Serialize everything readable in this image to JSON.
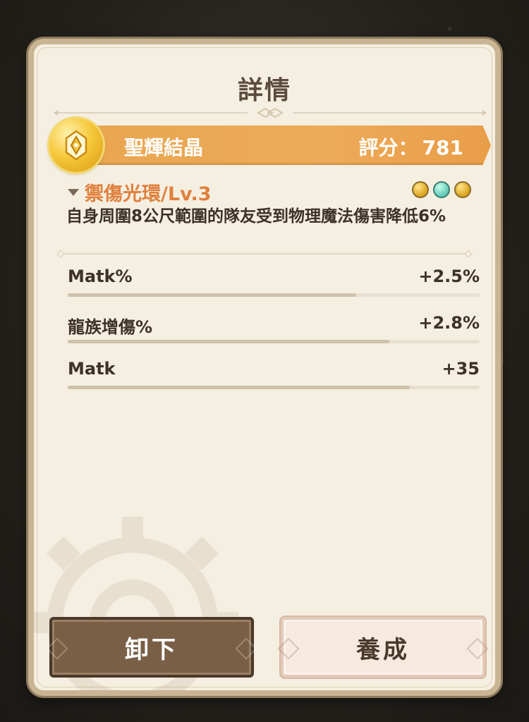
{
  "dialog": {
    "title": "詳情"
  },
  "item": {
    "name": "聖輝結晶",
    "score_label": "評分：",
    "score_value": "781",
    "icon": "golden-crystal-icon",
    "banner_color": "#eba754"
  },
  "skill": {
    "title": "禦傷光環/Lv.3",
    "description": "自身周圍8公尺範圍的隊友受到物理魔法傷害降低6%",
    "gems": [
      {
        "icon": "gold-gem-icon",
        "color": "#e3ad25"
      },
      {
        "icon": "teal-gem-icon",
        "color": "#6fd1bc"
      },
      {
        "icon": "gold-gem-icon",
        "color": "#e3ad25"
      }
    ]
  },
  "stats": [
    {
      "label": "Matk%",
      "value": "+2.5%",
      "fill_fraction": 0.7
    },
    {
      "label": "龍族增傷%",
      "value": "+2.8%",
      "fill_fraction": 0.78
    },
    {
      "label": "Matk",
      "value": "+35",
      "fill_fraction": 0.83
    }
  ],
  "buttons": {
    "unequip": "卸下",
    "upgrade": "養成"
  }
}
